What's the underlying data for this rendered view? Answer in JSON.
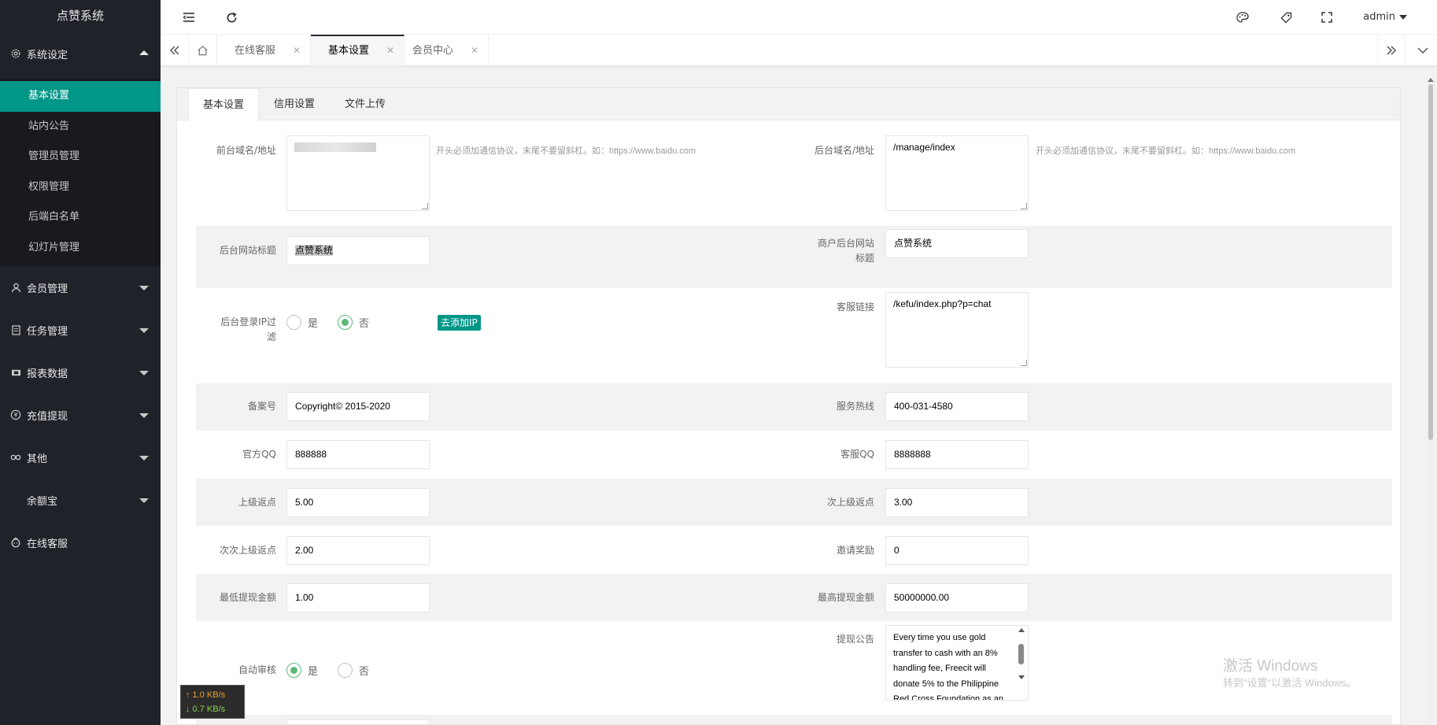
{
  "app": {
    "title": "点赞系统"
  },
  "sidebar": {
    "groups": [
      {
        "label": "系统设定",
        "icon": "gear-icon",
        "expanded": true
      },
      {
        "label": "会员管理",
        "icon": "user-icon"
      },
      {
        "label": "任务管理",
        "icon": "document-icon"
      },
      {
        "label": "报表数据",
        "icon": "report-icon"
      },
      {
        "label": "充值提现",
        "icon": "yen-icon"
      },
      {
        "label": "其他",
        "icon": "link-icon"
      },
      {
        "label": "余额宝",
        "icon": ""
      },
      {
        "label": "在线客服",
        "icon": "headset-icon"
      }
    ],
    "sub_items": [
      {
        "label": "基本设置",
        "active": true
      },
      {
        "label": "站内公告"
      },
      {
        "label": "管理员管理"
      },
      {
        "label": "权限管理"
      },
      {
        "label": "后端白名单"
      },
      {
        "label": "幻灯片管理"
      }
    ]
  },
  "header": {
    "user": "admin"
  },
  "page_tabs": [
    {
      "label": "在线客服"
    },
    {
      "label": "基本设置",
      "active": true
    },
    {
      "label": "会员中心"
    }
  ],
  "form_tabs": [
    {
      "label": "基本设置",
      "active": true
    },
    {
      "label": "信用设置"
    },
    {
      "label": "文件上传"
    }
  ],
  "form": {
    "front_domain": {
      "label": "前台域名/地址",
      "hint": "开头必须加通信协议，末尾不要留斜杠。如：https://www.baidu.com"
    },
    "admin_domain": {
      "label": "后台域名/地址",
      "value": "/manage/index",
      "hint": "开头必须加通信协议，末尾不要留斜杠。如：https://www.baidu.com"
    },
    "admin_site_title": {
      "label": "后台网站标题",
      "value": "点赞系统"
    },
    "merchant_site_title": {
      "label_1": "商户后台网站",
      "label_2": "标题",
      "value": "点赞系统"
    },
    "ip_filter": {
      "label_1": "后台登录IP过",
      "label_2": "滤",
      "yes": "是",
      "no": "否",
      "selected": "否",
      "add_button": "去添加IP"
    },
    "kefu_link": {
      "label": "客服链接",
      "value": "/kefu/index.php?p=chat"
    },
    "icp": {
      "label": "备案号",
      "value": "Copyright© 2015-2020"
    },
    "service_hotline": {
      "label": "服务热线",
      "value": "400-031-4580"
    },
    "official_qq": {
      "label": "官方QQ",
      "value": "888888"
    },
    "kefu_qq": {
      "label": "客服QQ",
      "value": "8888888"
    },
    "rebate_1": {
      "label": "上级返点",
      "value": "5.00"
    },
    "rebate_2": {
      "label": "次上级返点",
      "value": "3.00"
    },
    "rebate_3": {
      "label": "次次上级返点",
      "value": "2.00"
    },
    "invite_reward": {
      "label": "邀请奖励",
      "value": "0"
    },
    "min_withdraw": {
      "label": "最低提现金额",
      "value": "1.00"
    },
    "max_withdraw": {
      "label": "最高提现金额",
      "value": "50000000.00"
    },
    "auto_review": {
      "label": "自动审核",
      "yes": "是",
      "no": "否",
      "selected": "是"
    },
    "withdraw_notice": {
      "label": "提现公告",
      "value": "Every time you use gold transfer to cash with an 8% handling fee, Freecit will donate 5% to the Philippine Red Cross Foundation as an"
    }
  },
  "netspeed": {
    "up": "↑ 1.0 KB/s",
    "down": "↓ 0.7 KB/s"
  },
  "watermark": {
    "line1": "激活 Windows",
    "line2": "转到\"设置\"以激活 Windows。"
  },
  "colors": {
    "sidebar": "#20222a",
    "accent": "#009688",
    "radio": "#5fb878"
  }
}
